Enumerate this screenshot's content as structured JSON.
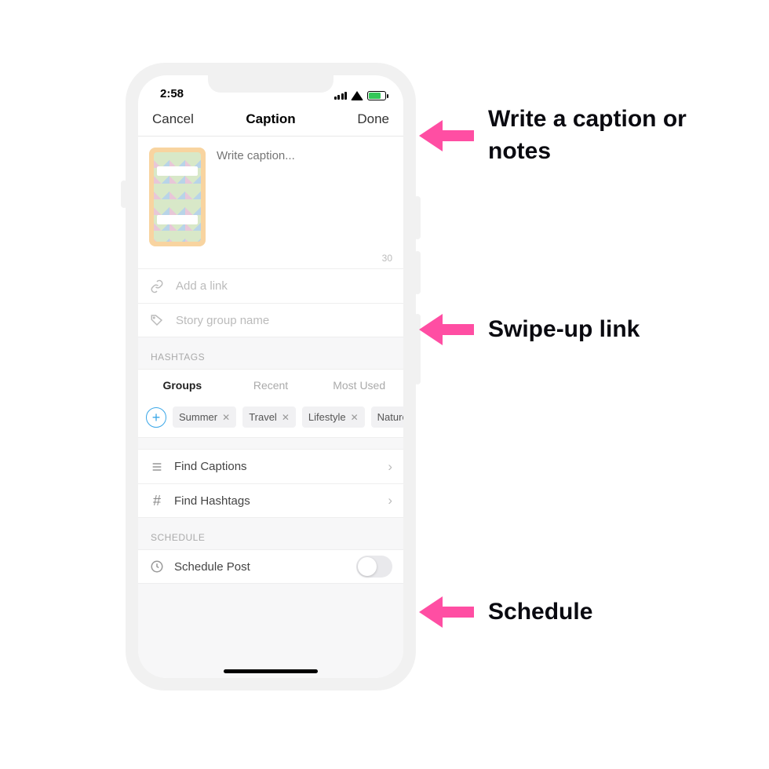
{
  "status": {
    "time": "2:58"
  },
  "nav": {
    "cancel": "Cancel",
    "title": "Caption",
    "done": "Done"
  },
  "caption": {
    "placeholder": "Write caption...",
    "char_count": "30"
  },
  "link": {
    "placeholder": "Add a link"
  },
  "group": {
    "placeholder": "Story group name"
  },
  "hashtags": {
    "label": "HASHTAGS",
    "tabs": {
      "groups": "Groups",
      "recent": "Recent",
      "most_used": "Most Used"
    },
    "chips": [
      "Summer",
      "Travel",
      "Lifestyle",
      "Nature"
    ]
  },
  "rows": {
    "find_captions": "Find Captions",
    "find_hashtags": "Find Hashtags"
  },
  "schedule": {
    "label": "SCHEDULE",
    "row": "Schedule Post"
  },
  "annotations": {
    "a1": "Write a caption or notes",
    "a2": "Swipe-up link",
    "a3": "Schedule"
  }
}
